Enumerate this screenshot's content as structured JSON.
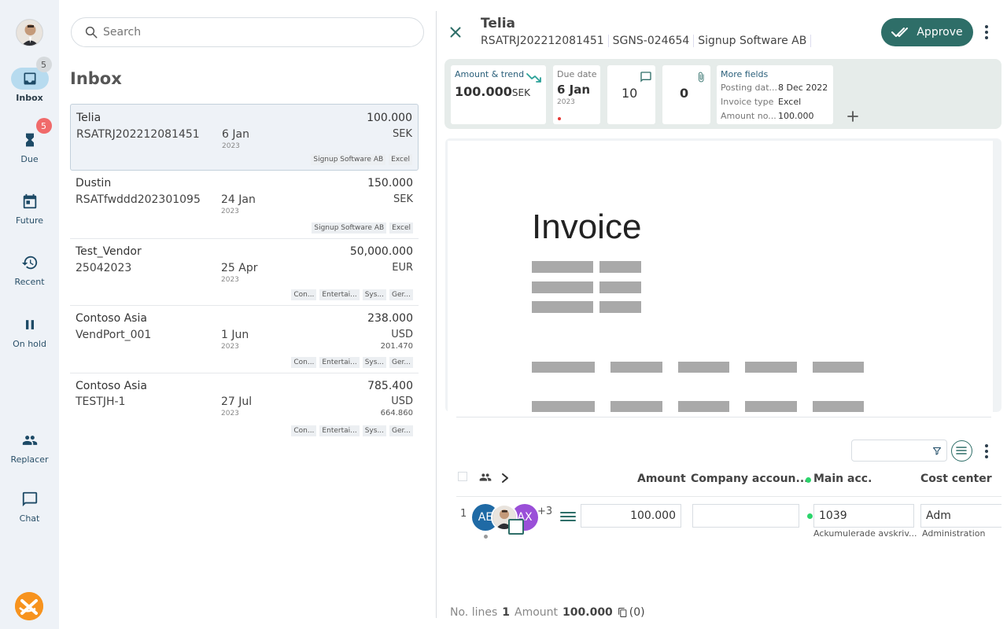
{
  "sidebar": {
    "items": [
      {
        "label": "Inbox",
        "badge": "5"
      },
      {
        "label": "Due",
        "badge": "5"
      },
      {
        "label": "Future"
      },
      {
        "label": "Recent"
      },
      {
        "label": "On hold"
      },
      {
        "label": "Replacer"
      },
      {
        "label": "Chat"
      }
    ]
  },
  "search": {
    "placeholder": "Search"
  },
  "inbox": {
    "title": "Inbox",
    "rows": [
      {
        "vendor": "Telia",
        "ref": "RSATRJ202212081451",
        "date": "6 Jan",
        "year": "2023",
        "amount": "100.000",
        "currency": "SEK",
        "tags": [
          "Signup Software AB",
          "Excel"
        ]
      },
      {
        "vendor": "Dustin",
        "ref": "RSATfwddd202301095",
        "date": "24 Jan",
        "year": "2023",
        "amount": "150.000",
        "currency": "SEK",
        "tags": [
          "Signup Software AB",
          "Excel"
        ]
      },
      {
        "vendor": "Test_Vendor",
        "ref": "25042023",
        "date": "25 Apr",
        "year": "2023",
        "amount": "50,000.000",
        "currency": "EUR",
        "tags": [
          "Con...",
          "Entertai...",
          "Sys...",
          "Ger..."
        ]
      },
      {
        "vendor": "Contoso Asia",
        "ref": "VendPort_001",
        "date": "1 Jun",
        "year": "2023",
        "amount": "238.000",
        "currency": "USD",
        "sub_amount": "201.470",
        "tags": [
          "Con...",
          "Entertai...",
          "Sys...",
          "Ger..."
        ]
      },
      {
        "vendor": "Contoso Asia",
        "ref": "TESTJH-1",
        "date": "27 Jul",
        "year": "2023",
        "amount": "785.400",
        "currency": "USD",
        "sub_amount": "664.860",
        "tags": [
          "Con...",
          "Entertai...",
          "Sys...",
          "Ger..."
        ]
      }
    ]
  },
  "detail": {
    "vendor": "Telia",
    "invoice_ref": "RSATRJ202212081451",
    "voucher": "SGNS-024654",
    "company": "Signup Software AB",
    "approve_label": "Approve",
    "cards": {
      "amount_label": "Amount & trend",
      "amount_value": "100.000",
      "amount_unit": "SEK",
      "due_label": "Due date",
      "due_value": "6 Jan",
      "due_year": "2023",
      "comments_count": "10",
      "attachments_count": "0",
      "more_fields_label": "More fields",
      "more_fields": [
        {
          "key": "Posting dat...",
          "value": "8 Dec 2022"
        },
        {
          "key": "Invoice type",
          "value": "Excel"
        },
        {
          "key": "Amount no...",
          "value": "100.000"
        }
      ]
    },
    "document": {
      "title": "Invoice"
    }
  },
  "grid": {
    "headers": {
      "amount": "Amount",
      "company_account": "Company accoun...",
      "main_account": "Main acc.",
      "cost_center": "Cost center"
    },
    "row": {
      "index": "1",
      "avatars": [
        {
          "initials": "AE",
          "color": "#1f6aa5"
        },
        {
          "initials": "AX",
          "color": "#9a4fd8"
        }
      ],
      "more_count": "+3",
      "amount": "100.000",
      "company_account": "",
      "main_account": "1039",
      "main_account_desc": "Ackumulerade avskriv...",
      "cost_center": "Adm",
      "cost_center_desc": "Administration"
    }
  },
  "footer": {
    "lines_label": "No. lines",
    "lines_value": "1",
    "amount_label": "Amount",
    "amount_value": "100.000",
    "copies": "(0)"
  },
  "colors": {
    "accent": "#2e6e68",
    "sidebar_bg": "#eef2f7",
    "badge_red": "#f06a6a",
    "active_nav": "#b7dbef"
  }
}
